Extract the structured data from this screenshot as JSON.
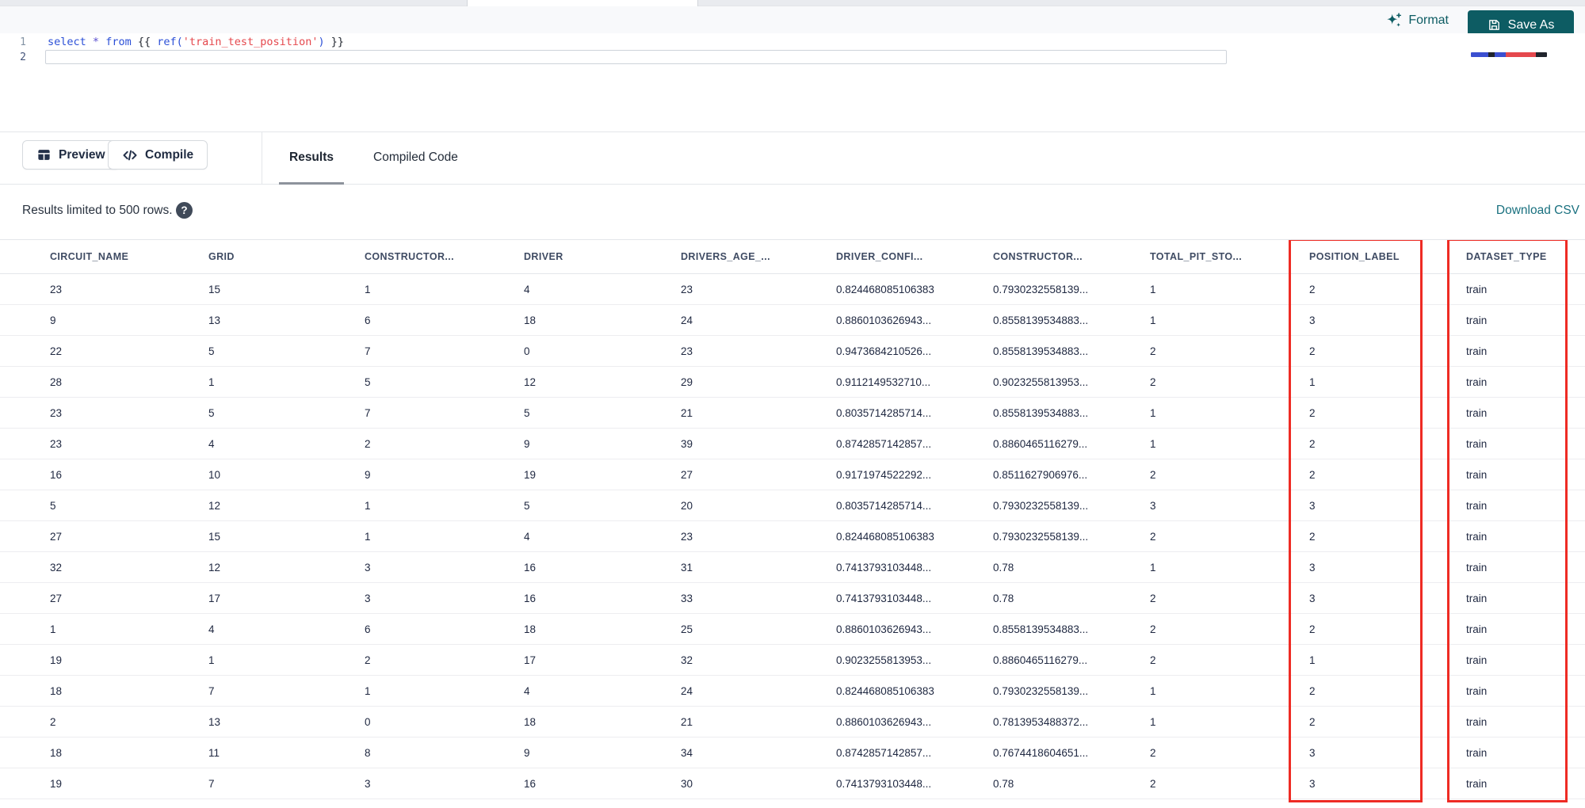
{
  "toolbar": {
    "format_label": "Format",
    "save_as_label": "Save As"
  },
  "editor": {
    "line_numbers": [
      "1",
      "2"
    ],
    "line1_tokens": [
      {
        "text": "select",
        "type": "keyword"
      },
      {
        "text": " ",
        "type": "plain"
      },
      {
        "text": "*",
        "type": "operator"
      },
      {
        "text": " ",
        "type": "plain"
      },
      {
        "text": "from",
        "type": "keyword"
      },
      {
        "text": " ",
        "type": "plain"
      },
      {
        "text": "{{ ",
        "type": "brace"
      },
      {
        "text": "ref(",
        "type": "function"
      },
      {
        "text": "'train_test_position'",
        "type": "string"
      },
      {
        "text": ")",
        "type": "function"
      },
      {
        "text": " }}",
        "type": "brace"
      }
    ]
  },
  "action_bar": {
    "preview_label": "Preview",
    "compile_label": "Compile"
  },
  "tabs": [
    {
      "label": "Results",
      "active": true
    },
    {
      "label": "Compiled Code",
      "active": false
    }
  ],
  "results_bar": {
    "limit_text": "Results limited to 500 rows.",
    "help_glyph": "?",
    "download_label": "Download CSV"
  },
  "table": {
    "columns": [
      "CIRCUIT_NAME",
      "GRID",
      "CONSTRUCTOR...",
      "DRIVER",
      "DRIVERS_AGE_...",
      "DRIVER_CONFI...",
      "CONSTRUCTOR...",
      "TOTAL_PIT_STO...",
      "POSITION_LABEL",
      "DATASET_TYPE"
    ],
    "highlighted_columns": [
      "POSITION_LABEL",
      "DATASET_TYPE"
    ],
    "rows": [
      [
        "23",
        "15",
        "1",
        "4",
        "23",
        "0.824468085106383",
        "0.7930232558139...",
        "1",
        "2",
        "train"
      ],
      [
        "9",
        "13",
        "6",
        "18",
        "24",
        "0.8860103626943...",
        "0.8558139534883...",
        "1",
        "3",
        "train"
      ],
      [
        "22",
        "5",
        "7",
        "0",
        "23",
        "0.9473684210526...",
        "0.8558139534883...",
        "2",
        "2",
        "train"
      ],
      [
        "28",
        "1",
        "5",
        "12",
        "29",
        "0.9112149532710...",
        "0.9023255813953...",
        "2",
        "1",
        "train"
      ],
      [
        "23",
        "5",
        "7",
        "5",
        "21",
        "0.8035714285714...",
        "0.8558139534883...",
        "1",
        "2",
        "train"
      ],
      [
        "23",
        "4",
        "2",
        "9",
        "39",
        "0.8742857142857...",
        "0.8860465116279...",
        "1",
        "2",
        "train"
      ],
      [
        "16",
        "10",
        "9",
        "19",
        "27",
        "0.9171974522292...",
        "0.8511627906976...",
        "2",
        "2",
        "train"
      ],
      [
        "5",
        "12",
        "1",
        "5",
        "20",
        "0.8035714285714...",
        "0.7930232558139...",
        "3",
        "3",
        "train"
      ],
      [
        "27",
        "15",
        "1",
        "4",
        "23",
        "0.824468085106383",
        "0.7930232558139...",
        "2",
        "2",
        "train"
      ],
      [
        "32",
        "12",
        "3",
        "16",
        "31",
        "0.7413793103448...",
        "0.78",
        "1",
        "3",
        "train"
      ],
      [
        "27",
        "17",
        "3",
        "16",
        "33",
        "0.7413793103448...",
        "0.78",
        "2",
        "3",
        "train"
      ],
      [
        "1",
        "4",
        "6",
        "18",
        "25",
        "0.8860103626943...",
        "0.8558139534883...",
        "2",
        "2",
        "train"
      ],
      [
        "19",
        "1",
        "2",
        "17",
        "32",
        "0.9023255813953...",
        "0.8860465116279...",
        "2",
        "1",
        "train"
      ],
      [
        "18",
        "7",
        "1",
        "4",
        "24",
        "0.824468085106383",
        "0.7930232558139...",
        "1",
        "2",
        "train"
      ],
      [
        "2",
        "13",
        "0",
        "18",
        "21",
        "0.8860103626943...",
        "0.7813953488372...",
        "1",
        "2",
        "train"
      ],
      [
        "18",
        "11",
        "8",
        "9",
        "34",
        "0.8742857142857...",
        "0.7674418604651...",
        "2",
        "3",
        "train"
      ],
      [
        "19",
        "7",
        "3",
        "16",
        "30",
        "0.7413793103448...",
        "0.78",
        "2",
        "3",
        "train"
      ]
    ]
  },
  "colors": {
    "accent_teal": "#0d5c63",
    "link_teal": "#19707f",
    "highlight_red": "#ee2b24"
  }
}
